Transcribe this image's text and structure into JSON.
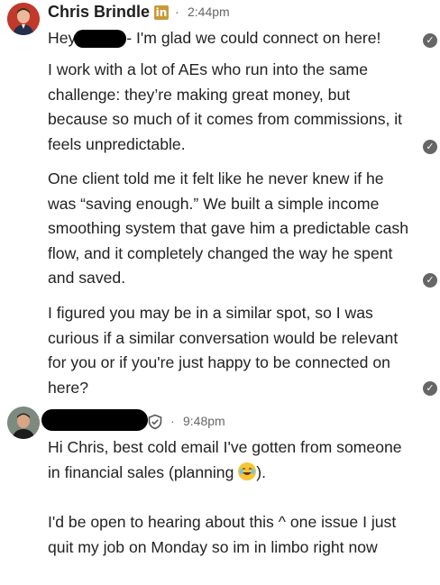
{
  "sender1": {
    "name": "Chris Brindle",
    "badge": "in",
    "separator": "·",
    "time": "2:44pm"
  },
  "messages1": [
    {
      "pre": "Hey",
      "post": "- I'm glad we could connect on here!"
    },
    {
      "text": "I work with a lot of AEs who run into the same challenge: they’re making great money, but because so much of it comes from commissions, it feels unpredictable."
    },
    {
      "text": "One client told me it felt like he never knew if he was “saving enough.” We built a simple income smoothing system that gave him a predictable cash flow, and it completely changed the way he spent and saved."
    },
    {
      "text": "I figured you may be in a similar spot, so I was curious if a similar conversation would be relevant for you or if you're just happy to be connected on here?"
    }
  ],
  "sender2": {
    "separator": "·",
    "time": "9:48pm"
  },
  "messages2": [
    {
      "pre": "Hi Chris, best cold email I've gotten from someone in financial sales (planning",
      "post": ")."
    },
    {
      "text": "I'd be open to hearing about this ^ one issue I just quit my job on Monday so im in limbo right now"
    }
  ],
  "icons": {
    "read_receipt": "check-circle-icon",
    "verified": "shield-check-icon",
    "emoji": "laughing-tears-emoji"
  }
}
